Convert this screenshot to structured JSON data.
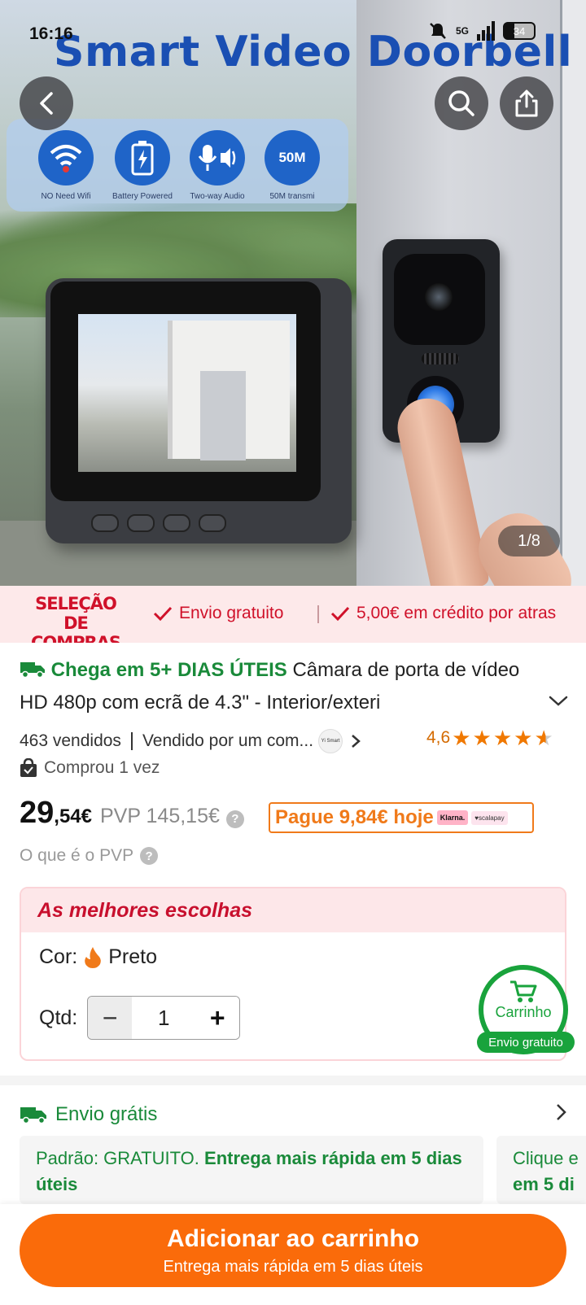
{
  "status_bar": {
    "time": "16:16",
    "network": "5G",
    "battery": "34"
  },
  "hero": {
    "title": "Smart Video Doorbell",
    "features": [
      {
        "icon": "wifi-off-icon",
        "caption": "NO Need Wifi"
      },
      {
        "icon": "battery-icon",
        "caption": "Battery Powered"
      },
      {
        "icon": "two-way-audio-icon",
        "caption": "Two-way Audio"
      },
      {
        "icon": "range-icon",
        "badge": "50M",
        "caption": "50M transmi"
      }
    ],
    "page_indicator": "1/8"
  },
  "promo": {
    "brand_line1": "SELEÇÃO",
    "brand_line2": "DE COMPRAS",
    "items": [
      "Envio gratuito",
      "5,00€ em crédito por atras"
    ]
  },
  "product": {
    "delivery_tag": "Chega em 5+ DIAS ÚTEIS",
    "title": "Câmara de porta de vídeo HD 480p com ecrã de 4.3\" - Interior/exteri",
    "sold": "463 vendidos",
    "seller": "Vendido por um com...",
    "seller_logo": "Yi Smart",
    "rating": "4,6",
    "purchased": "Comprou 1 vez",
    "price_int": "29",
    "price_dec": ",54€",
    "rrp": "PVP 145,15€",
    "pay_today": "Pague 9,84€ hoje",
    "klarna": "Klarna.",
    "scalapay": "♥scalapay",
    "rrp_question": "O que é o PVP"
  },
  "choice": {
    "header": "As melhores escolhas",
    "color_label": "Cor:",
    "color_value": "Preto",
    "qty_label": "Qtd:",
    "qty_value": "1"
  },
  "cart_fab": {
    "label": "Carrinho",
    "pill": "Envio gratuito"
  },
  "shipping": {
    "header": "Envio grátis",
    "card1_prefix": "Padrão: GRATUITO. ",
    "card1_bold": "Entrega mais rápida em 5 dias úteis",
    "card2_prefix": "Clique e",
    "card2_bold": "em 5 di"
  },
  "cta": {
    "label": "Adicionar ao carrinho",
    "sub": "Entrega mais rápida em 5 dias úteis"
  },
  "colors": {
    "accent": "#fa6b0a",
    "green": "#1a8a3a",
    "red": "#d0112a"
  }
}
